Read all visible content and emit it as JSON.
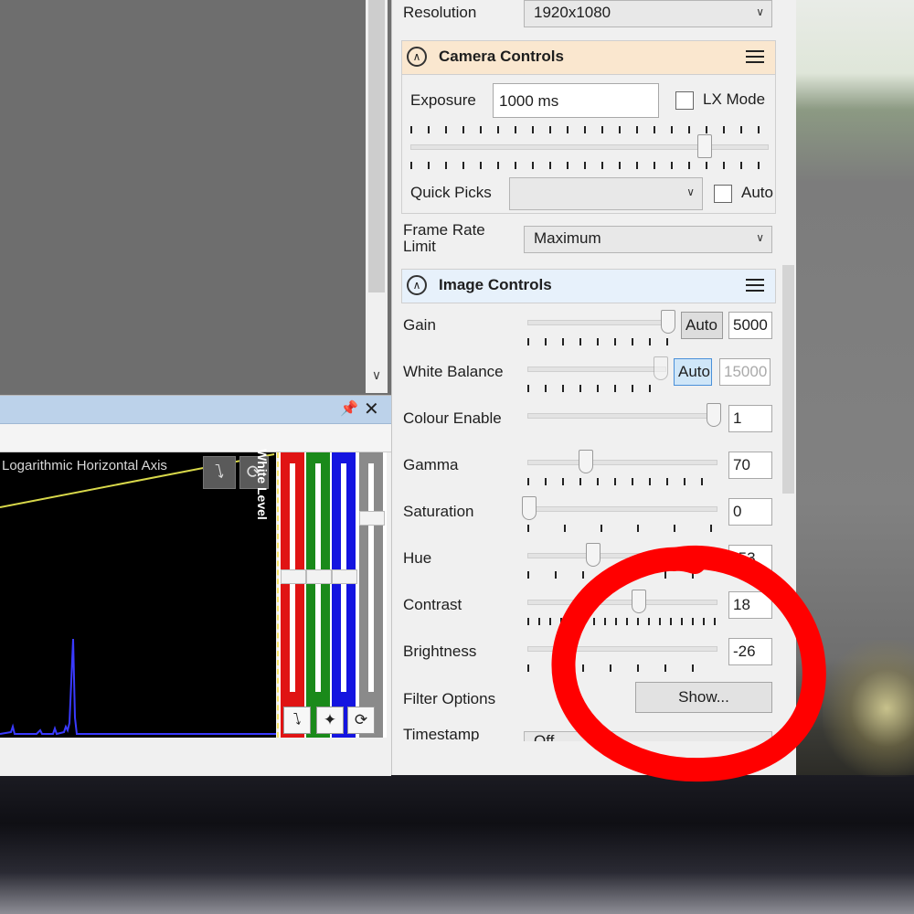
{
  "histogram": {
    "axis_label": "Logarithmic Horizontal Axis",
    "white_level_label": "White Level",
    "buttons": {
      "auto_icon": "lightning-icon",
      "reset_icon": "reset-icon",
      "star_icon": "star-icon"
    },
    "channels": [
      {
        "name": "red",
        "color": "#e01414"
      },
      {
        "name": "green",
        "color": "#1a8a1a"
      },
      {
        "name": "blue",
        "color": "#1414e0"
      },
      {
        "name": "gray",
        "color": "#8a8a8a"
      }
    ]
  },
  "resolution": {
    "label": "Resolution",
    "value": "1920x1080"
  },
  "camera_controls": {
    "title": "Camera Controls",
    "exposure_label": "Exposure",
    "exposure_value": "1000 ms",
    "lx_mode_label": "LX Mode",
    "quick_picks_label": "Quick Picks",
    "quick_picks_value": "",
    "auto_label": "Auto"
  },
  "frame_rate": {
    "label_line1": "Frame Rate",
    "label_line2": "Limit",
    "value": "Maximum"
  },
  "image_controls": {
    "title": "Image Controls",
    "gain": {
      "label": "Gain",
      "auto": "Auto",
      "value": "5000"
    },
    "white_balance": {
      "label": "White Balance",
      "auto": "Auto",
      "value": "15000"
    },
    "colour_enable": {
      "label": "Colour Enable",
      "value": "1"
    },
    "gamma": {
      "label": "Gamma",
      "value": "70"
    },
    "saturation": {
      "label": "Saturation",
      "value": "0"
    },
    "hue": {
      "label": "Hue",
      "value": "-53"
    },
    "contrast": {
      "label": "Contrast",
      "value": "18"
    },
    "brightness": {
      "label": "Brightness",
      "value": "-26"
    },
    "filter_options": {
      "label": "Filter Options",
      "button": "Show..."
    },
    "timestamp": {
      "label": "Timestamp",
      "value": "Off"
    }
  },
  "colors": {
    "annotation_red": "#ff0000",
    "section_camera_bg": "#fae7cf",
    "section_image_bg": "#e7f1fb",
    "auto_active_bg": "#cfe6f8"
  }
}
